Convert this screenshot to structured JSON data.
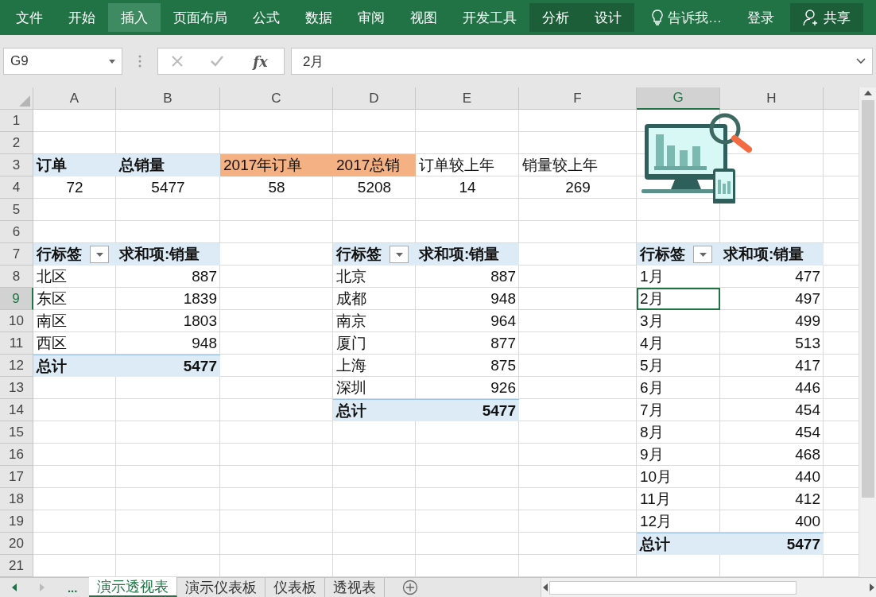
{
  "ribbon": [
    {
      "label": "文件",
      "kind": "tab",
      "hovered": false
    },
    {
      "label": "开始",
      "kind": "tab",
      "hovered": false
    },
    {
      "label": "插入",
      "kind": "tab",
      "hovered": true
    },
    {
      "label": "页面布局",
      "kind": "tab",
      "hovered": false
    },
    {
      "label": "公式",
      "kind": "tab",
      "hovered": false
    },
    {
      "label": "数据",
      "kind": "tab",
      "hovered": false
    },
    {
      "label": "审阅",
      "kind": "tab",
      "hovered": false
    },
    {
      "label": "视图",
      "kind": "tab",
      "hovered": false
    },
    {
      "label": "开发工具",
      "kind": "tab",
      "hovered": false
    },
    {
      "label": "分析",
      "kind": "contextual",
      "hovered": false
    },
    {
      "label": "设计",
      "kind": "contextual",
      "hovered": false
    },
    {
      "label": "告诉我…",
      "kind": "search",
      "hovered": false
    },
    {
      "label": "登录",
      "kind": "tab",
      "hovered": false
    },
    {
      "label": "共享",
      "kind": "share",
      "hovered": false
    }
  ],
  "formula_bar": {
    "name_box": "G9",
    "function_label": "fx",
    "value": "2月"
  },
  "columns": [
    {
      "header": "A",
      "selected": false
    },
    {
      "header": "B",
      "selected": false
    },
    {
      "header": "C",
      "selected": false
    },
    {
      "header": "D",
      "selected": false
    },
    {
      "header": "E",
      "selected": false
    },
    {
      "header": "F",
      "selected": false
    },
    {
      "header": "G",
      "selected": true
    },
    {
      "header": "H",
      "selected": false
    }
  ],
  "rows": [
    {
      "header": "1",
      "selected": false
    },
    {
      "header": "2",
      "selected": false
    },
    {
      "header": "3",
      "selected": false,
      "cells": [
        {
          "kind": "head",
          "text": "订单"
        },
        {
          "kind": "head",
          "text": "总销量"
        },
        {
          "kind": "highlight",
          "text": "2017年订单"
        },
        {
          "kind": "highlight",
          "text": "2017总销"
        },
        {
          "kind": "plain",
          "text": "订单较上年"
        },
        {
          "kind": "plain",
          "text": "销量较上年"
        },
        {
          "kind": "empty"
        },
        {
          "kind": "empty"
        }
      ]
    },
    {
      "header": "4",
      "selected": false,
      "cells": [
        {
          "kind": "centered",
          "text": "72"
        },
        {
          "kind": "centered",
          "text": "5477"
        },
        {
          "kind": "centered",
          "text": "58"
        },
        {
          "kind": "centered",
          "text": "5208"
        },
        {
          "kind": "centered",
          "text": "14"
        },
        {
          "kind": "centered",
          "text": "269"
        },
        {
          "kind": "empty"
        },
        {
          "kind": "empty"
        }
      ]
    },
    {
      "header": "5",
      "selected": false
    },
    {
      "header": "6",
      "selected": false
    },
    {
      "header": "7",
      "selected": false,
      "cells": [
        {
          "kind": "head-filter",
          "text": "行标签"
        },
        {
          "kind": "head",
          "text": "求和项:销量"
        },
        {
          "kind": "empty"
        },
        {
          "kind": "head-filter",
          "text": "行标签"
        },
        {
          "kind": "head",
          "text": "求和项:销量"
        },
        {
          "kind": "empty"
        },
        {
          "kind": "head-filter",
          "text": "行标签"
        },
        {
          "kind": "head",
          "text": "求和项:销量"
        }
      ]
    },
    {
      "header": "8",
      "selected": false,
      "cells": [
        {
          "kind": "plain",
          "text": "北区"
        },
        {
          "kind": "number",
          "text": "887"
        },
        {
          "kind": "empty"
        },
        {
          "kind": "plain",
          "text": "北京"
        },
        {
          "kind": "number",
          "text": "887"
        },
        {
          "kind": "empty"
        },
        {
          "kind": "plain",
          "text": "1月"
        },
        {
          "kind": "number",
          "text": "477"
        }
      ]
    },
    {
      "header": "9",
      "selected": true,
      "cells": [
        {
          "kind": "plain",
          "text": "东区"
        },
        {
          "kind": "number",
          "text": "1839"
        },
        {
          "kind": "empty"
        },
        {
          "kind": "plain",
          "text": "成都"
        },
        {
          "kind": "number",
          "text": "948"
        },
        {
          "kind": "empty"
        },
        {
          "kind": "plain",
          "text": "2月"
        },
        {
          "kind": "number",
          "text": "497"
        }
      ]
    },
    {
      "header": "10",
      "selected": false,
      "cells": [
        {
          "kind": "plain",
          "text": "南区"
        },
        {
          "kind": "number",
          "text": "1803"
        },
        {
          "kind": "empty"
        },
        {
          "kind": "plain",
          "text": "南京"
        },
        {
          "kind": "number",
          "text": "964"
        },
        {
          "kind": "empty"
        },
        {
          "kind": "plain",
          "text": "3月"
        },
        {
          "kind": "number",
          "text": "499"
        }
      ]
    },
    {
      "header": "11",
      "selected": false,
      "cells": [
        {
          "kind": "plain",
          "text": "西区"
        },
        {
          "kind": "number",
          "text": "948"
        },
        {
          "kind": "empty"
        },
        {
          "kind": "plain",
          "text": "厦门"
        },
        {
          "kind": "number",
          "text": "877"
        },
        {
          "kind": "empty"
        },
        {
          "kind": "plain",
          "text": "4月"
        },
        {
          "kind": "number",
          "text": "513"
        }
      ]
    },
    {
      "header": "12",
      "selected": false,
      "cells": [
        {
          "kind": "total-label",
          "text": "总计"
        },
        {
          "kind": "total",
          "text": "5477"
        },
        {
          "kind": "empty"
        },
        {
          "kind": "plain",
          "text": "上海"
        },
        {
          "kind": "number",
          "text": "875"
        },
        {
          "kind": "empty"
        },
        {
          "kind": "plain",
          "text": "5月"
        },
        {
          "kind": "number",
          "text": "417"
        }
      ]
    },
    {
      "header": "13",
      "selected": false,
      "cells": [
        {
          "kind": "empty"
        },
        {
          "kind": "empty"
        },
        {
          "kind": "empty"
        },
        {
          "kind": "plain",
          "text": "深圳"
        },
        {
          "kind": "number",
          "text": "926"
        },
        {
          "kind": "empty"
        },
        {
          "kind": "plain",
          "text": "6月"
        },
        {
          "kind": "number",
          "text": "446"
        }
      ]
    },
    {
      "header": "14",
      "selected": false,
      "cells": [
        {
          "kind": "empty"
        },
        {
          "kind": "empty"
        },
        {
          "kind": "empty"
        },
        {
          "kind": "total-label",
          "text": "总计"
        },
        {
          "kind": "total",
          "text": "5477"
        },
        {
          "kind": "empty"
        },
        {
          "kind": "plain",
          "text": "7月"
        },
        {
          "kind": "number",
          "text": "454"
        }
      ]
    },
    {
      "header": "15",
      "selected": false,
      "cells": [
        {
          "kind": "empty"
        },
        {
          "kind": "empty"
        },
        {
          "kind": "empty"
        },
        {
          "kind": "empty"
        },
        {
          "kind": "empty"
        },
        {
          "kind": "empty"
        },
        {
          "kind": "plain",
          "text": "8月"
        },
        {
          "kind": "number",
          "text": "454"
        }
      ]
    },
    {
      "header": "16",
      "selected": false,
      "cells": [
        {
          "kind": "empty"
        },
        {
          "kind": "empty"
        },
        {
          "kind": "empty"
        },
        {
          "kind": "empty"
        },
        {
          "kind": "empty"
        },
        {
          "kind": "empty"
        },
        {
          "kind": "plain",
          "text": "9月"
        },
        {
          "kind": "number",
          "text": "468"
        }
      ]
    },
    {
      "header": "17",
      "selected": false,
      "cells": [
        {
          "kind": "empty"
        },
        {
          "kind": "empty"
        },
        {
          "kind": "empty"
        },
        {
          "kind": "empty"
        },
        {
          "kind": "empty"
        },
        {
          "kind": "empty"
        },
        {
          "kind": "plain",
          "text": "10月"
        },
        {
          "kind": "number",
          "text": "440"
        }
      ]
    },
    {
      "header": "18",
      "selected": false,
      "cells": [
        {
          "kind": "empty"
        },
        {
          "kind": "empty"
        },
        {
          "kind": "empty"
        },
        {
          "kind": "empty"
        },
        {
          "kind": "empty"
        },
        {
          "kind": "empty"
        },
        {
          "kind": "plain",
          "text": "11月"
        },
        {
          "kind": "number",
          "text": "412"
        }
      ]
    },
    {
      "header": "19",
      "selected": false,
      "cells": [
        {
          "kind": "empty"
        },
        {
          "kind": "empty"
        },
        {
          "kind": "empty"
        },
        {
          "kind": "empty"
        },
        {
          "kind": "empty"
        },
        {
          "kind": "empty"
        },
        {
          "kind": "plain",
          "text": "12月"
        },
        {
          "kind": "number",
          "text": "400"
        }
      ]
    },
    {
      "header": "20",
      "selected": false,
      "cells": [
        {
          "kind": "empty"
        },
        {
          "kind": "empty"
        },
        {
          "kind": "empty"
        },
        {
          "kind": "empty"
        },
        {
          "kind": "empty"
        },
        {
          "kind": "empty"
        },
        {
          "kind": "total-label",
          "text": "总计"
        },
        {
          "kind": "total",
          "text": "5477"
        }
      ]
    },
    {
      "header": "21",
      "selected": false
    }
  ],
  "sheet_tabs": {
    "more": "...",
    "tabs": [
      {
        "label": "演示透视表",
        "selected": true
      },
      {
        "label": "演示仪表板",
        "selected": false
      },
      {
        "label": "仪表板",
        "selected": false
      },
      {
        "label": "透视表",
        "selected": false
      }
    ]
  }
}
